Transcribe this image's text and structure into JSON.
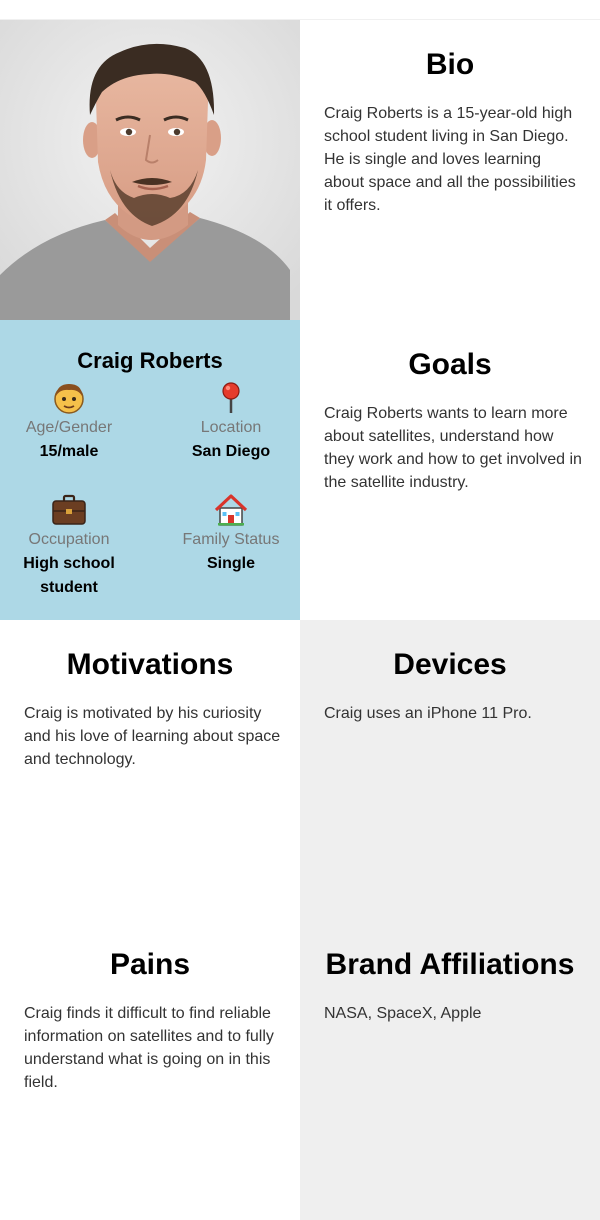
{
  "bio": {
    "title": "Bio",
    "text": "Craig Roberts is a 15-year-old high school student living in San Diego. He is single and loves learning about space and all the possibilities it offers."
  },
  "profile": {
    "name": "Craig Roberts",
    "age_gender": {
      "label": "Age/Gender",
      "value": "15/male",
      "icon": "man-face-icon"
    },
    "location": {
      "label": "Location",
      "value": "San Diego",
      "icon": "round-pushpin-icon"
    },
    "occupation": {
      "label": "Occupation",
      "value": "High school student",
      "icon": "briefcase-icon"
    },
    "family_status": {
      "label": "Family Status",
      "value": "Single",
      "icon": "house-icon"
    }
  },
  "goals": {
    "title": "Goals",
    "text": "Craig Roberts wants to learn more about satellites, understand how they work and how to get involved in the satellite industry."
  },
  "motivations": {
    "title": "Motivations",
    "text": "Craig is motivated by his curiosity and his love of learning about space and technology."
  },
  "devices": {
    "title": "Devices",
    "text": "Craig uses an iPhone 11 Pro."
  },
  "pains": {
    "title": "Pains",
    "text": "Craig finds it difficult to find reliable information on satellites and to fully understand what is going on in this field."
  },
  "brand_affiliations": {
    "title": "Brand Affiliations",
    "text": "NASA, SpaceX, Apple"
  },
  "colors": {
    "profile_bg": "#add8e6",
    "grey_cell": "#efefef",
    "text_body": "#333333",
    "label_grey": "#777777"
  }
}
